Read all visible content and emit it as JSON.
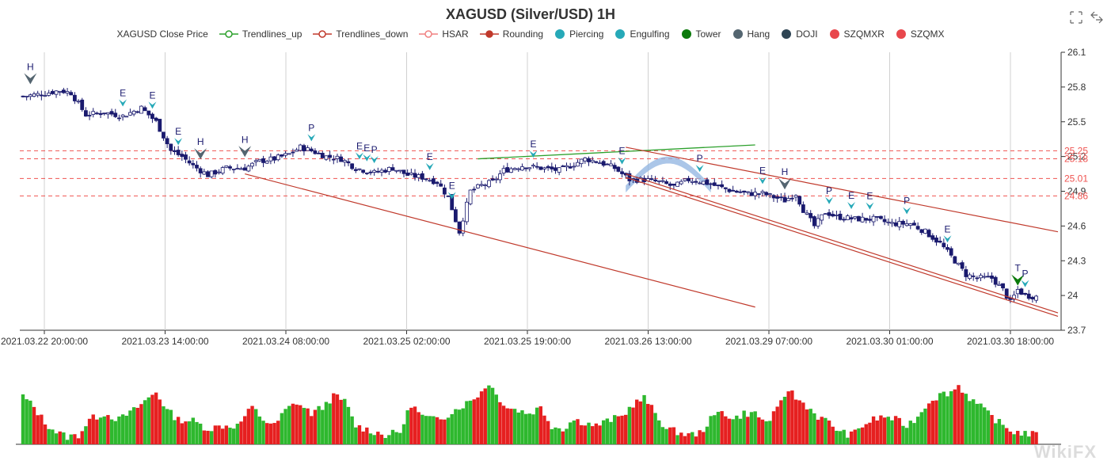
{
  "chart_data": {
    "type": "candlestick",
    "title": "XAGUSD (Silver/USD) 1H",
    "legend": [
      {
        "name": "XAGUSD Close Price",
        "kind": "none",
        "color": "#333333"
      },
      {
        "name": "Trendlines_up",
        "kind": "line-hollow",
        "color": "#2ca02c"
      },
      {
        "name": "Trendlines_down",
        "kind": "line-hollow",
        "color": "#c0392b"
      },
      {
        "name": "HSAR",
        "kind": "line-hollow",
        "color": "#f08080"
      },
      {
        "name": "Rounding",
        "kind": "line-dot",
        "color": "#c0392b"
      },
      {
        "name": "Piercing",
        "kind": "dot",
        "color": "#26a9b8"
      },
      {
        "name": "Engulfing",
        "kind": "dot",
        "color": "#26a9b8"
      },
      {
        "name": "Tower",
        "kind": "dot",
        "color": "#0b7a0b"
      },
      {
        "name": "Hang",
        "kind": "dot",
        "color": "#546570"
      },
      {
        "name": "DOJI",
        "kind": "dot",
        "color": "#2f4554"
      },
      {
        "name": "SZQMXR",
        "kind": "dot",
        "color": "#e8474c"
      },
      {
        "name": "SZQMX",
        "kind": "dot",
        "color": "#e8474c"
      }
    ],
    "x_tick_labels": [
      "2021.03.22 20:00:00",
      "2021.03.23 14:00:00",
      "2021.03.24 08:00:00",
      "2021.03.25 02:00:00",
      "2021.03.25 19:00:00",
      "2021.03.26 13:00:00",
      "2021.03.29 07:00:00",
      "2021.03.30 01:00:00",
      "2021.03.30 18:00:00"
    ],
    "y_ticks": [
      23.7,
      24,
      24.3,
      24.6,
      24.9,
      25.2,
      25.5,
      25.8,
      26.1
    ],
    "ylim": [
      23.7,
      26.1
    ],
    "hsar_levels": [
      {
        "value": 25.25,
        "label": "25.25"
      },
      {
        "value": 25.18,
        "label": "25.18"
      },
      {
        "value": 25.01,
        "label": "25.01"
      },
      {
        "value": 24.86,
        "label": "24.86"
      }
    ],
    "close_keypoints": [
      [
        0,
        25.72
      ],
      [
        5,
        25.74
      ],
      [
        10,
        25.77
      ],
      [
        13,
        25.75
      ],
      [
        17,
        25.56
      ],
      [
        22,
        25.58
      ],
      [
        27,
        25.55
      ],
      [
        32,
        25.62
      ],
      [
        36,
        25.5
      ],
      [
        40,
        25.25
      ],
      [
        43,
        25.2
      ],
      [
        46,
        25.12
      ],
      [
        50,
        25.04
      ],
      [
        55,
        25.1
      ],
      [
        60,
        25.1
      ],
      [
        64,
        25.16
      ],
      [
        68,
        25.18
      ],
      [
        72,
        25.22
      ],
      [
        75,
        25.28
      ],
      [
        78,
        25.25
      ],
      [
        82,
        25.2
      ],
      [
        86,
        25.18
      ],
      [
        90,
        25.1
      ],
      [
        95,
        25.06
      ],
      [
        100,
        25.1
      ],
      [
        104,
        25.04
      ],
      [
        108,
        25.02
      ],
      [
        112,
        24.98
      ],
      [
        115,
        24.85
      ],
      [
        118,
        24.55
      ],
      [
        121,
        24.9
      ],
      [
        124,
        24.95
      ],
      [
        127,
        24.98
      ],
      [
        130,
        25.08
      ],
      [
        135,
        25.12
      ],
      [
        140,
        25.1
      ],
      [
        145,
        25.08
      ],
      [
        148,
        25.12
      ],
      [
        152,
        25.18
      ],
      [
        156,
        25.15
      ],
      [
        160,
        25.1
      ],
      [
        164,
        25.0
      ],
      [
        168,
        25.0
      ],
      [
        172,
        24.98
      ],
      [
        176,
        24.94
      ],
      [
        180,
        25.0
      ],
      [
        184,
        24.98
      ],
      [
        188,
        24.94
      ],
      [
        192,
        24.9
      ],
      [
        196,
        24.88
      ],
      [
        200,
        24.88
      ],
      [
        203,
        24.85
      ],
      [
        206,
        24.82
      ],
      [
        209,
        24.88
      ],
      [
        211,
        24.74
      ],
      [
        214,
        24.6
      ],
      [
        217,
        24.72
      ],
      [
        220,
        24.68
      ],
      [
        225,
        24.66
      ],
      [
        230,
        24.66
      ],
      [
        235,
        24.62
      ],
      [
        240,
        24.62
      ],
      [
        244,
        24.55
      ],
      [
        248,
        24.45
      ],
      [
        252,
        24.3
      ],
      [
        255,
        24.18
      ],
      [
        258,
        24.15
      ],
      [
        262,
        24.15
      ],
      [
        265,
        24.05
      ],
      [
        267,
        23.94
      ],
      [
        269,
        24.05
      ],
      [
        271,
        24.0
      ],
      [
        274,
        23.99
      ]
    ],
    "volume_keypoints": [
      [
        0,
        0.78
      ],
      [
        3,
        0.6
      ],
      [
        6,
        0.35
      ],
      [
        9,
        0.2
      ],
      [
        12,
        0.12
      ],
      [
        15,
        0.15
      ],
      [
        18,
        0.4
      ],
      [
        22,
        0.5
      ],
      [
        26,
        0.4
      ],
      [
        30,
        0.55
      ],
      [
        33,
        0.7
      ],
      [
        36,
        0.85
      ],
      [
        39,
        0.55
      ],
      [
        42,
        0.4
      ],
      [
        46,
        0.38
      ],
      [
        50,
        0.25
      ],
      [
        54,
        0.3
      ],
      [
        58,
        0.3
      ],
      [
        62,
        0.6
      ],
      [
        65,
        0.4
      ],
      [
        68,
        0.3
      ],
      [
        71,
        0.55
      ],
      [
        74,
        0.68
      ],
      [
        78,
        0.5
      ],
      [
        81,
        0.6
      ],
      [
        84,
        0.78
      ],
      [
        87,
        0.7
      ],
      [
        90,
        0.3
      ],
      [
        94,
        0.22
      ],
      [
        98,
        0.15
      ],
      [
        102,
        0.2
      ],
      [
        105,
        0.65
      ],
      [
        108,
        0.45
      ],
      [
        111,
        0.4
      ],
      [
        114,
        0.45
      ],
      [
        118,
        0.6
      ],
      [
        121,
        0.7
      ],
      [
        124,
        0.85
      ],
      [
        126,
        1.0
      ],
      [
        128,
        0.8
      ],
      [
        131,
        0.6
      ],
      [
        134,
        0.55
      ],
      [
        137,
        0.5
      ],
      [
        140,
        0.6
      ],
      [
        143,
        0.3
      ],
      [
        146,
        0.25
      ],
      [
        149,
        0.4
      ],
      [
        152,
        0.35
      ],
      [
        155,
        0.3
      ],
      [
        159,
        0.4
      ],
      [
        162,
        0.45
      ],
      [
        165,
        0.65
      ],
      [
        168,
        0.75
      ],
      [
        171,
        0.5
      ],
      [
        174,
        0.25
      ],
      [
        177,
        0.2
      ],
      [
        180,
        0.15
      ],
      [
        183,
        0.18
      ],
      [
        186,
        0.4
      ],
      [
        189,
        0.55
      ],
      [
        192,
        0.4
      ],
      [
        195,
        0.5
      ],
      [
        198,
        0.5
      ],
      [
        201,
        0.35
      ],
      [
        204,
        0.55
      ],
      [
        207,
        0.9
      ],
      [
        209,
        0.75
      ],
      [
        212,
        0.62
      ],
      [
        215,
        0.45
      ],
      [
        218,
        0.35
      ],
      [
        221,
        0.2
      ],
      [
        224,
        0.15
      ],
      [
        227,
        0.3
      ],
      [
        230,
        0.4
      ],
      [
        233,
        0.45
      ],
      [
        236,
        0.4
      ],
      [
        239,
        0.3
      ],
      [
        242,
        0.45
      ],
      [
        245,
        0.7
      ],
      [
        248,
        0.8
      ],
      [
        251,
        0.85
      ],
      [
        253,
        0.95
      ],
      [
        256,
        0.75
      ],
      [
        259,
        0.6
      ],
      [
        262,
        0.45
      ],
      [
        265,
        0.3
      ],
      [
        268,
        0.2
      ],
      [
        271,
        0.18
      ],
      [
        274,
        0.15
      ]
    ],
    "n_bars": 275,
    "signals": [
      {
        "label": "H",
        "bar": 2,
        "kind": "hang"
      },
      {
        "label": "E",
        "bar": 27,
        "kind": "engulf"
      },
      {
        "label": "E",
        "bar": 35,
        "kind": "engulf"
      },
      {
        "label": "E",
        "bar": 42,
        "kind": "engulf"
      },
      {
        "label": "H",
        "bar": 48,
        "kind": "hang"
      },
      {
        "label": "H",
        "bar": 60,
        "kind": "hang"
      },
      {
        "label": "P",
        "bar": 78,
        "kind": "pierce"
      },
      {
        "label": "E",
        "bar": 91,
        "kind": "engulf"
      },
      {
        "label": "E",
        "bar": 93,
        "kind": "engulf"
      },
      {
        "label": "P",
        "bar": 95,
        "kind": "pierce"
      },
      {
        "label": "E",
        "bar": 110,
        "kind": "engulf"
      },
      {
        "label": "E",
        "bar": 116,
        "kind": "engulf"
      },
      {
        "label": "E",
        "bar": 138,
        "kind": "engulf"
      },
      {
        "label": "E",
        "bar": 162,
        "kind": "engulf"
      },
      {
        "label": "P",
        "bar": 183,
        "kind": "pierce"
      },
      {
        "label": "E",
        "bar": 200,
        "kind": "engulf"
      },
      {
        "label": "H",
        "bar": 206,
        "kind": "hang"
      },
      {
        "label": "P",
        "bar": 218,
        "kind": "pierce"
      },
      {
        "label": "E",
        "bar": 224,
        "kind": "engulf"
      },
      {
        "label": "E",
        "bar": 229,
        "kind": "engulf"
      },
      {
        "label": "P",
        "bar": 239,
        "kind": "pierce"
      },
      {
        "label": "E",
        "bar": 250,
        "kind": "engulf"
      },
      {
        "label": "T",
        "bar": 285,
        "kind": "tower"
      },
      {
        "label": "P",
        "bar": 289,
        "kind": "pierce"
      }
    ],
    "trendlines_up": [
      [
        [
          123,
          25.18
        ],
        [
          198,
          25.3
        ]
      ]
    ],
    "trendlines_down": [
      [
        [
          60,
          25.05
        ],
        [
          198,
          23.9
        ]
      ],
      [
        [
          163,
          25.28
        ],
        [
          295,
          24.55
        ]
      ],
      [
        [
          163,
          25.05
        ],
        [
          288,
          23.85
        ]
      ],
      [
        [
          163,
          25.02
        ],
        [
          288,
          23.82
        ]
      ]
    ],
    "rounding": {
      "from_bar": 163,
      "to_bar": 186,
      "low": 24.95,
      "high": 25.2
    }
  },
  "watermark": "WikiFX",
  "toolbar": {
    "zoom_icon": "zoom-icon",
    "restore_icon": "restore-icon"
  }
}
